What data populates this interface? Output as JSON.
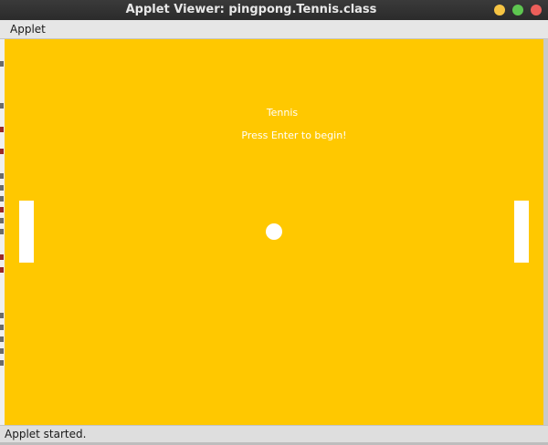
{
  "window": {
    "title": "Applet Viewer: pingpong.Tennis.class"
  },
  "menubar": {
    "items": [
      {
        "label": "Applet"
      }
    ]
  },
  "game": {
    "title": "Tennis",
    "prompt": "Press Enter to begin!"
  },
  "status": {
    "text": "Applet started."
  },
  "colors": {
    "applet_background": "#ffc800",
    "foreground": "#ffffff",
    "minimize_button": "#f6c443",
    "maximize_button": "#5ec650",
    "close_button": "#ec5f5a"
  },
  "icons": {
    "minimize": "minimize-icon",
    "maximize": "maximize-icon",
    "close": "close-icon"
  }
}
